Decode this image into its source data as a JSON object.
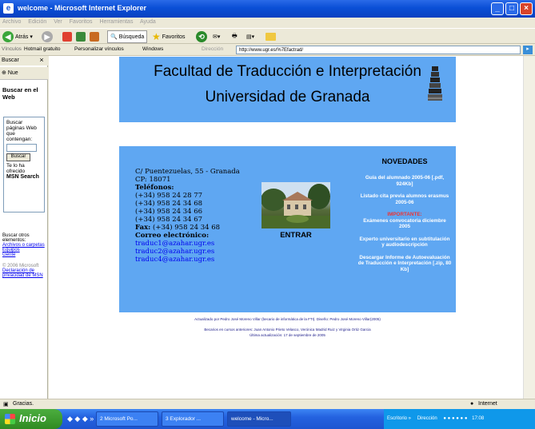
{
  "window": {
    "title": "welcome - Microsoft Internet Explorer"
  },
  "menu": [
    "Archivo",
    "Edición",
    "Ver",
    "Favoritos",
    "Herramientas",
    "Ayuda"
  ],
  "toolbar": {
    "back": "Atrás",
    "search": "Búsqueda",
    "favorites": "Favoritos"
  },
  "links": {
    "label": "Vínculos",
    "items": [
      "Hotmail gratuito",
      "Personalizar vínculos",
      "Windows"
    ],
    "address_label": "Dirección",
    "address": "http://www.ugr.es/%7Efactrad/"
  },
  "sidebar": {
    "title": "Buscar",
    "new": "Nue",
    "heading": "Buscar en el Web",
    "panel_text": "Buscar páginas Web que contengan:",
    "search_button": "Buscar",
    "powered": "Te lo ha ofrecido",
    "brand": "MSN Search",
    "other_text": "Buscar otros elementos:",
    "links": [
      "Archivos o carpetas",
      "Equipos",
      "Gente"
    ],
    "copyright": "© 2006 Microsoft",
    "legal_link": "Declaración de privacidad de MSN"
  },
  "page": {
    "title_line1": "Facultad de Traducción e Interpretación",
    "title_line2": "Universidad de Granada",
    "address_lines": [
      "C/ Puentezuelas, 55 - Granada",
      "CP: 18071"
    ],
    "phones_label": "Teléfonos:",
    "phones": [
      "(+34) 958 24 28 77",
      "(+34) 958 24 34 68",
      "(+34) 958 24 34 66",
      "(+34) 958 24 34 67"
    ],
    "fax_label": "Fax:",
    "fax": "(+34) 958 24 34 68",
    "email_label": "Correo electrónico:",
    "emails": [
      "traduc1@azahar.ugr.es",
      "traduc2@azahar.ugr.es",
      "traduc4@azahar.ugr.es"
    ],
    "enter": "ENTRAR",
    "news_title": "NOVEDADES",
    "news": [
      "Guía del alumnado 2005-06 [.pdf, 924Kb]",
      "Listado cita previa alumnos erasmus 2005-06"
    ],
    "important_label": "IMPORTANTE:",
    "important_text": "Exámenes convocatoria diciembre 2005",
    "news_more": [
      "Experto universitario en subtitulación y audiodescripción",
      "Descargar Informe de Autoevaluación de Traducción e Interpretación [.zip, 80 Kb]"
    ],
    "footer_lines": [
      "Actualizado por Pedro José Moreno Villar (becario de informática de la FTI). Diseño: Pedro José Moreno Villar(2005)",
      "Becarios en cursos anteriores: Juan Antonio Prieto Velasco, Verónica Madrid Ruiz y Virginia Ortiz Garcia",
      "Última actualización: 17 de septiembre de 2005"
    ]
  },
  "status": {
    "text": "Gracias.",
    "zone": "Internet"
  },
  "taskbar": {
    "start": "Inicio",
    "tasks": [
      "2 Microsoft Po...",
      "3 Explorador ...",
      "welcome - Micro..."
    ],
    "tray": [
      "Escritorio",
      "Dirección"
    ],
    "clock": "17:08"
  },
  "colors": {
    "page_bg": "#5fa7f2",
    "link": "#0000ee",
    "important": "#ee3333"
  }
}
